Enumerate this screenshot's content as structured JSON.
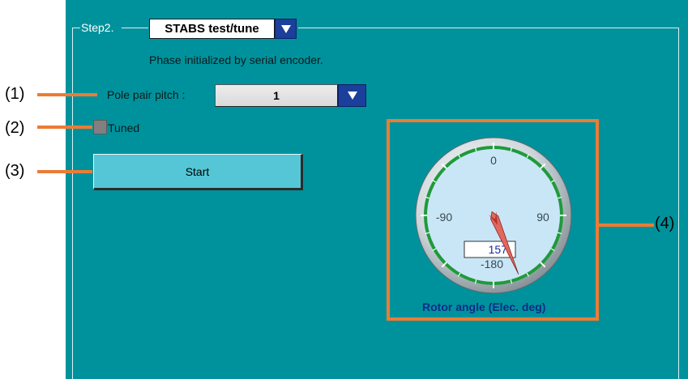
{
  "step": {
    "label": "Step2.",
    "mode_select": "STABS test/tune",
    "info_text": "Phase initialized by serial encoder."
  },
  "pole_pair": {
    "label": "Pole pair pitch :",
    "value": "1"
  },
  "tuned": {
    "label": "Tuned",
    "checked": false
  },
  "start_button": {
    "label": "Start"
  },
  "gauge": {
    "tick_labels": [
      "0",
      "90",
      "-180",
      "-90"
    ],
    "readout": "157",
    "angle_deg": 157,
    "caption": "Rotor angle (Elec. deg)"
  },
  "callouts": [
    "(1)",
    "(2)",
    "(3)",
    "(4)"
  ],
  "colors": {
    "panel": "#00929c",
    "accent": "#ec7c34",
    "arrow_button": "#1b3f9a",
    "gauge_ring": "#1f9a3c",
    "needle": "#d9534f"
  }
}
